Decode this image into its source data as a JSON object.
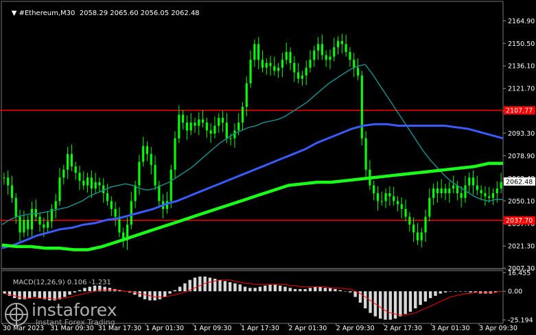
{
  "header": {
    "symbol": "#Ethereum,M30",
    "ohlc": "2058.29 2065.60 2056.05 2062.48",
    "menu_arrow_icon": "triangle-down-icon"
  },
  "colors": {
    "background": "#000000",
    "candle": "#00ff00",
    "ma_fast": "#1a8c8c",
    "ma_mid": "#3a5cff",
    "ma_slow": "#1aff1a",
    "level_line": "#ff0000",
    "price_badge": "#ffffff",
    "level_badge": "#ff0000",
    "macd_hist": "#d8d8d8",
    "macd_signal": "#ff0000"
  },
  "chart_data": [
    {
      "type": "candlestick",
      "symbol": "#Ethereum",
      "timeframe": "M30",
      "last_price": "2062.48",
      "ylim": [
        2007.0,
        2172.0
      ],
      "y_tick_labels": [
        "2164.90",
        "2150.50",
        "2136.10",
        "2121.70",
        "2107.77",
        "2093.30",
        "2078.90",
        "2062.48",
        "2050.10",
        "2037.70",
        "2021.30",
        "2007.30"
      ],
      "y_tick_values": [
        2164.9,
        2150.5,
        2136.1,
        2121.7,
        2107.3,
        2093.3,
        2078.9,
        2064.5,
        2050.1,
        2035.7,
        2021.3,
        2007.3
      ],
      "x_tick_labels": [
        "30 Mar 2023",
        "31 Mar 09:30",
        "31 Mar 17:30",
        "1 Apr 01:30",
        "1 Apr 09:30",
        "1 Apr 17:30",
        "2 Apr 01:30",
        "2 Apr 09:30",
        "2 Apr 17:30",
        "3 Apr 01:30",
        "3 Apr 09:30"
      ],
      "horizontal_levels": [
        {
          "value": 2107.77,
          "label": "2107.77"
        },
        {
          "value": 2037.7,
          "label": "2037.70"
        }
      ],
      "closes": [
        2065,
        2060,
        2052,
        2040,
        2030,
        2038,
        2032,
        2045,
        2040,
        2035,
        2033,
        2037,
        2045,
        2050,
        2065,
        2070,
        2080,
        2072,
        2068,
        2063,
        2060,
        2065,
        2058,
        2062,
        2060,
        2055,
        2050,
        2045,
        2040,
        2030,
        2025,
        2035,
        2050,
        2060,
        2075,
        2085,
        2080,
        2073,
        2060,
        2050,
        2045,
        2050,
        2070,
        2090,
        2105,
        2100,
        2095,
        2100,
        2098,
        2102,
        2100,
        2095,
        2093,
        2098,
        2103,
        2100,
        2090,
        2090,
        2095,
        2100,
        2110,
        2125,
        2140,
        2150,
        2140,
        2135,
        2138,
        2136,
        2133,
        2135,
        2140,
        2145,
        2138,
        2132,
        2128,
        2130,
        2135,
        2140,
        2146,
        2150,
        2143,
        2140,
        2142,
        2148,
        2152,
        2150,
        2145,
        2140,
        2135,
        2130,
        2090,
        2070,
        2060,
        2055,
        2050,
        2050,
        2055,
        2053,
        2050,
        2048,
        2045,
        2040,
        2035,
        2030,
        2025,
        2030,
        2040,
        2052,
        2058,
        2055,
        2058,
        2055,
        2058,
        2060,
        2055,
        2052,
        2060,
        2065,
        2060,
        2057,
        2055,
        2053,
        2052,
        2055,
        2058,
        2062
      ],
      "ma_fast": [
        2035,
        2038,
        2040,
        2041,
        2042,
        2042,
        2043,
        2044,
        2045,
        2046,
        2048,
        2050,
        2053,
        2055,
        2057,
        2059,
        2060,
        2061,
        2060,
        2058,
        2057,
        2058,
        2060,
        2062,
        2065,
        2068,
        2071,
        2075,
        2079,
        2083,
        2087,
        2090,
        2093,
        2095,
        2097,
        2098,
        2100,
        2101,
        2102,
        2104,
        2107,
        2110,
        2113,
        2117,
        2121,
        2125,
        2128,
        2131,
        2134,
        2136,
        2137,
        2131,
        2124,
        2117,
        2110,
        2103,
        2096,
        2089,
        2082,
        2076,
        2071,
        2066,
        2062,
        2059,
        2056,
        2053,
        2051,
        2050,
        2051,
        2051
      ],
      "ma_mid": [
        2020,
        2022,
        2025,
        2028,
        2030,
        2032,
        2033,
        2035,
        2036,
        2038,
        2039,
        2041,
        2043,
        2045,
        2048,
        2050,
        2053,
        2056,
        2059,
        2062,
        2065,
        2068,
        2071,
        2074,
        2077,
        2080,
        2083,
        2087,
        2090,
        2093,
        2096,
        2098,
        2099,
        2099,
        2098,
        2098,
        2098,
        2098,
        2098,
        2097,
        2096,
        2094,
        2092,
        2090
      ],
      "ma_slow": [
        2022,
        2021,
        2021,
        2020,
        2020,
        2019,
        2019,
        2021,
        2024,
        2027,
        2030,
        2033,
        2036,
        2039,
        2042,
        2045,
        2048,
        2051,
        2054,
        2057,
        2060,
        2061,
        2062,
        2062,
        2063,
        2064,
        2065,
        2066,
        2067,
        2068,
        2069,
        2070,
        2071,
        2072,
        2074,
        2074
      ],
      "macd": {
        "label": "MACD(12,26,9)",
        "values": "0.106 -1.231",
        "ylim": [
          -27.0,
          17.0
        ],
        "y_tick_labels": [
          "16.455",
          "0.00",
          "-25.194"
        ],
        "y_tick_values": [
          16.455,
          0.0,
          -25.194
        ],
        "histogram": [
          -2,
          -4,
          -6,
          -7,
          -7,
          -6,
          -5,
          -6,
          -7,
          -8,
          -8,
          -7,
          -5,
          -3,
          -1,
          1,
          3,
          4,
          5,
          5,
          4,
          3,
          2,
          1,
          0,
          -1,
          -3,
          -5,
          -7,
          -8,
          -8,
          -7,
          -5,
          -2,
          1,
          4,
          7,
          10,
          12,
          13,
          13,
          12,
          11,
          10,
          9,
          8,
          7,
          6,
          4,
          3,
          3,
          4,
          5,
          6,
          6,
          5,
          4,
          3,
          2,
          2,
          2,
          3,
          4,
          4,
          3,
          3,
          2,
          1,
          0,
          -1,
          -5,
          -10,
          -15,
          -19,
          -22,
          -24,
          -25,
          -25,
          -24,
          -22,
          -20,
          -18,
          -15,
          -12,
          -9,
          -6,
          -4,
          -2,
          -1,
          0,
          0,
          0,
          0,
          -1,
          -1,
          -2,
          -2,
          -2,
          -1,
          0
        ],
        "signal": [
          -2,
          -3,
          -4,
          -5,
          -6,
          -6,
          -6,
          -6,
          -6,
          -6,
          -7,
          -6,
          -6,
          -5,
          -4,
          -3,
          -2,
          -1,
          0,
          1,
          1,
          1,
          1,
          1,
          0,
          0,
          -1,
          -2,
          -3,
          -4,
          -5,
          -5,
          -5,
          -4,
          -3,
          -2,
          -1,
          1,
          3,
          5,
          7,
          8,
          9,
          10,
          10,
          10,
          9,
          8,
          7,
          7,
          6,
          6,
          6,
          6,
          6,
          6,
          6,
          5,
          5,
          4,
          4,
          4,
          4,
          4,
          4,
          3,
          3,
          3,
          2,
          2,
          0,
          -2,
          -5,
          -8,
          -11,
          -14,
          -17,
          -19,
          -20,
          -21,
          -21,
          -20,
          -19,
          -17,
          -15,
          -13,
          -11,
          -9,
          -7,
          -5,
          -4,
          -3,
          -2,
          -2,
          -1,
          -1,
          -1,
          -1,
          -1,
          0
        ]
      }
    }
  ],
  "watermark": {
    "brand": "instaforex",
    "tagline": "Instant Forex Trading"
  }
}
